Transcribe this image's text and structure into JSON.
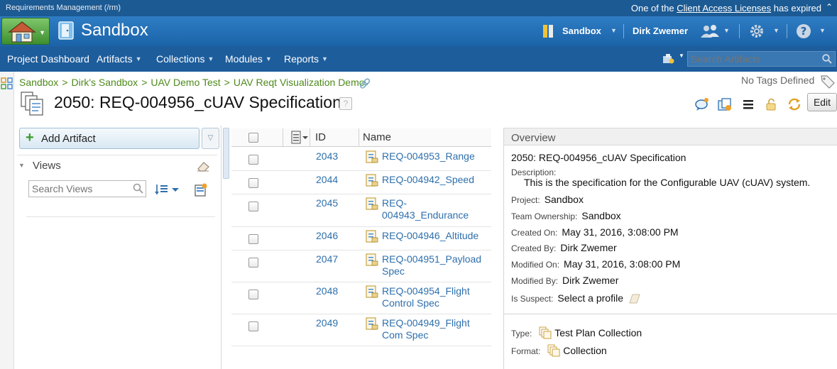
{
  "topstrip": {
    "app_title": "Requirements Management (/rm)",
    "license_prefix": "One of the",
    "license_link": "Client Access Licenses",
    "license_suffix": "has expired"
  },
  "banner": {
    "project_name": "Sandbox",
    "context_label": "Sandbox",
    "user_name": "Dirk Zwemer",
    "help_icon": "help-icon",
    "gear_icon": "gear-icon"
  },
  "nav": {
    "items": [
      {
        "label": "Project Dashboard",
        "dropdown": false
      },
      {
        "label": "Artifacts",
        "dropdown": true
      },
      {
        "label": "Collections",
        "dropdown": true
      },
      {
        "label": "Modules",
        "dropdown": true
      },
      {
        "label": "Reports",
        "dropdown": true
      }
    ],
    "search_placeholder": "Search Artifacts"
  },
  "breadcrumb": [
    "Sandbox",
    "Dirk's Sandbox",
    "UAV Demo Test",
    "UAV Reqt Visualization Demo"
  ],
  "tags_label": "No Tags Defined",
  "title": "2050: REQ-004956_cUAV Specification",
  "edit_label": "Edit",
  "left_panel": {
    "add_artifact": "Add Artifact",
    "views_label": "Views",
    "search_views_placeholder": "Search Views"
  },
  "table": {
    "columns": [
      "ID",
      "Name"
    ],
    "rows": [
      {
        "id": "2043",
        "name": "REQ-004953_Range"
      },
      {
        "id": "2044",
        "name": "REQ-004942_Speed"
      },
      {
        "id": "2045",
        "name": "REQ-004943_Endurance"
      },
      {
        "id": "2046",
        "name": "REQ-004946_Altitude"
      },
      {
        "id": "2047",
        "name": "REQ-004951_Payload Spec"
      },
      {
        "id": "2048",
        "name": "REQ-004954_Flight Control Spec"
      },
      {
        "id": "2049",
        "name": "REQ-004949_Flight Com Spec"
      }
    ]
  },
  "overview": {
    "header": "Overview",
    "heading": "2050: REQ-004956_cUAV Specification",
    "description_label": "Description:",
    "description": "This is the specification for the Configurable UAV (cUAV) system.",
    "project_label": "Project:",
    "project": "Sandbox",
    "team_label": "Team Ownership:",
    "team": "Sandbox",
    "created_on_label": "Created On:",
    "created_on": "May 31, 2016, 3:08:00 PM",
    "created_by_label": "Created By:",
    "created_by": "Dirk Zwemer",
    "modified_on_label": "Modified On:",
    "modified_on": "May 31, 2016, 3:08:00 PM",
    "modified_by_label": "Modified By:",
    "modified_by": "Dirk Zwemer",
    "suspect_label": "Is Suspect:",
    "suspect": "Select a profile",
    "type_label": "Type:",
    "type": "Test Plan Collection",
    "format_label": "Format:",
    "format": "Collection"
  }
}
